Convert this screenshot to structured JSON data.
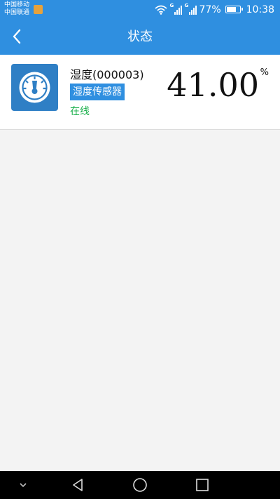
{
  "status_bar": {
    "carrier_1": "中国移动",
    "carrier_2": "中国联通",
    "sim1_network": "G",
    "sim2_network": "G",
    "battery_percent": "77%",
    "battery_level": 0.77,
    "time": "10:38",
    "icons": [
      "wifi-icon",
      "signal-icon",
      "battery-icon"
    ]
  },
  "app_bar": {
    "title": "状态",
    "back_icon": "chevron-left-icon"
  },
  "device": {
    "name": "湿度(000003)",
    "type": "湿度传感器",
    "status": "在线",
    "value": "41.00",
    "unit": "%",
    "icon": "gauge-icon"
  },
  "nav_bar": {
    "icons": [
      "chevron-down-icon",
      "back-triangle-icon",
      "home-circle-icon",
      "recents-square-icon"
    ]
  },
  "colors": {
    "primary": "#2f8fe0",
    "device_icon_bg": "#2f7fc5",
    "online": "#1bb04c",
    "background": "#f3f3f3"
  }
}
